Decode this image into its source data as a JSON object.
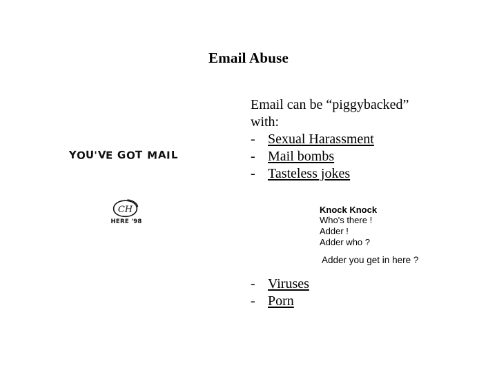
{
  "slide": {
    "title": "Email Abuse",
    "background_color": "#ffffff",
    "text_color": "#000000"
  },
  "body": {
    "intro": [
      "Email can be “piggybacked”",
      "with:"
    ],
    "dash": "-",
    "links_upper": [
      "Sexual Harassment",
      "Mail bombs",
      "Tasteless jokes"
    ],
    "links_lower": [
      "Viruses",
      "Porn"
    ]
  },
  "joke": {
    "heading": "Knock Knock",
    "lines": [
      "Who's there !",
      "Adder !",
      "Adder who ?"
    ],
    "punchline": "Adder you get in here ?"
  },
  "artwork": {
    "mail_banner": {
      "icon": "youve-got-mail-handwritten-art",
      "text": "YOU'VE GOT MAIL"
    },
    "logo": {
      "icon": "ch-monogram-circle-art",
      "monogram": "CH",
      "caption": "HERE '98"
    }
  }
}
